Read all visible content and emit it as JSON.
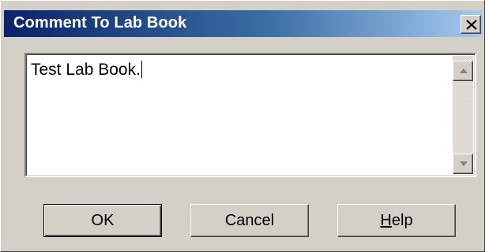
{
  "window": {
    "title": "Comment To Lab Book",
    "close_icon": "close-x-icon"
  },
  "comment": {
    "value": "Test Lab Book."
  },
  "scrollbar": {
    "up_icon": "arrow-up-icon",
    "down_icon": "arrow-down-icon"
  },
  "buttons": {
    "ok_label": "OK",
    "cancel_label": "Cancel",
    "help_mnemonic": "H",
    "help_rest": "elp"
  },
  "colors": {
    "titlebar_start": "#0a246a",
    "titlebar_end": "#a6caf0",
    "face": "#d4d0c8"
  }
}
